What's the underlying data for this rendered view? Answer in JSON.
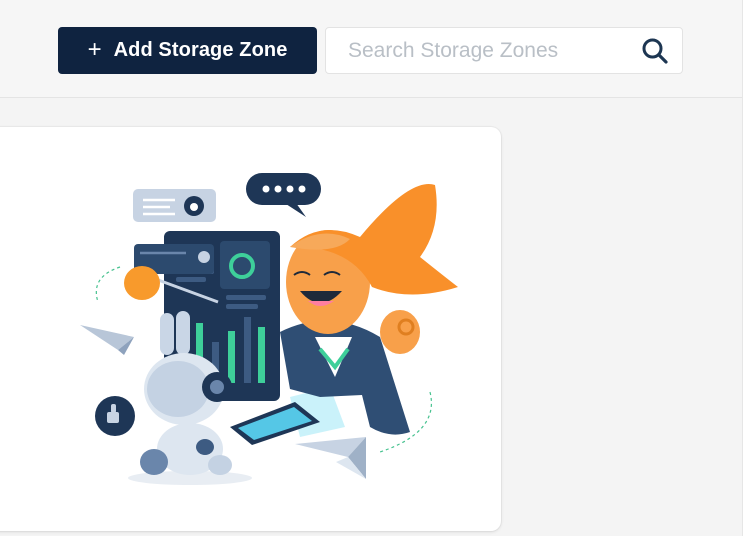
{
  "toolbar": {
    "add_label": "Add Storage Zone",
    "add_icon": "plus-icon"
  },
  "search": {
    "placeholder": "Search Storage Zones",
    "value": "",
    "icon": "search-icon"
  },
  "empty_state": {
    "illustration": "storage-zone-illustration"
  },
  "colors": {
    "primary_dark": "#0f2340",
    "accent_orange": "#f89a2c",
    "accent_teal": "#3ecf9a"
  }
}
